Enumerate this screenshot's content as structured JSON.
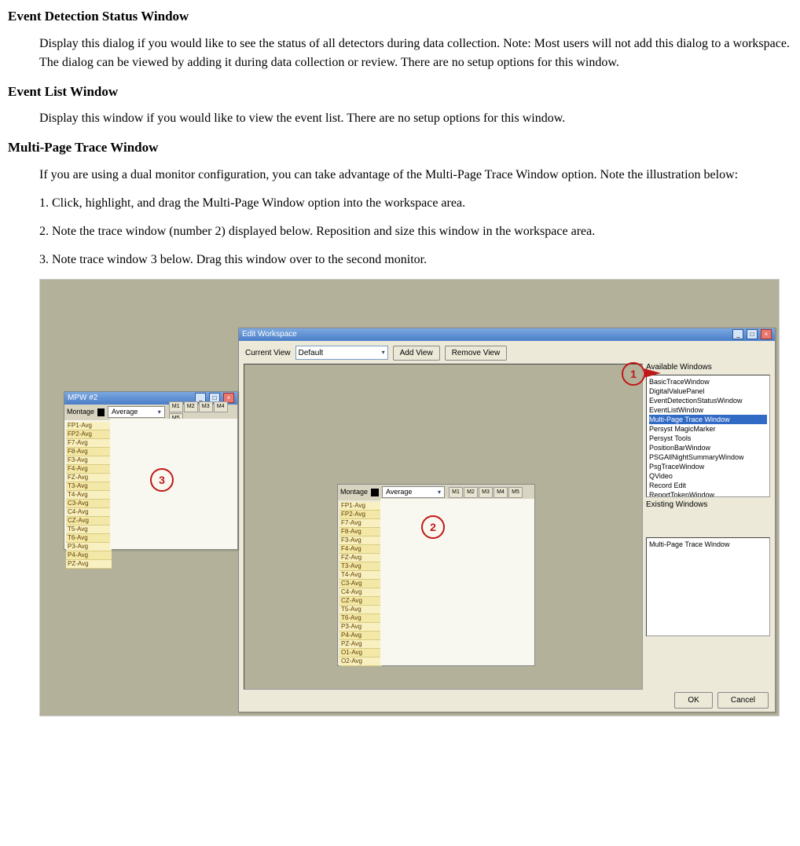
{
  "sections": {
    "s1": {
      "heading": "Event Detection Status Window",
      "body": "Display this dialog if you would like to see the status of all detectors during data collection.  Note:  Most users will not add this dialog to a workspace.  The dialog can be viewed by adding it during data collection or review.  There are no setup options for this window."
    },
    "s2": {
      "heading": "Event List Window",
      "body": "Display this window if you would like to view the event list.  There are no setup options for this window."
    },
    "s3": {
      "heading": "Multi-Page Trace Window",
      "intro": "If you are using a dual monitor configuration, you can take advantage of the Multi-Page Trace Window option.  Note the illustration below:",
      "step1": "1.  Click, highlight, and drag the Multi-Page Window option into the workspace area.",
      "step2": "2.  Note the trace window (number 2) displayed below.  Reposition and size this window in the workspace area.",
      "step3": "3.  Note trace window 3 below.  Drag this window over to the second monitor."
    }
  },
  "dialog": {
    "title": "Edit Workspace",
    "current_view_label": "Current View",
    "current_view_value": "Default",
    "add_view": "Add View",
    "remove_view": "Remove View",
    "available_label": "Available Windows",
    "available": [
      "BasicTraceWindow",
      "DigitalValuePanel",
      "EventDetectionStatusWindow",
      "EventListWindow",
      "Multi-Page Trace Window",
      "Persyst MagicMarker",
      "Persyst Tools",
      "PositionBarWindow",
      "PSGAllNightSummaryWindow",
      "PsgTraceWindow",
      "QVideo",
      "Record Edit",
      "ReportTokenWindow"
    ],
    "available_selected_index": 4,
    "existing_label": "Existing Windows",
    "existing": [
      "Multi-Page Trace Window"
    ],
    "ok": "OK",
    "cancel": "Cancel"
  },
  "mpw": {
    "float_title": "MPW #2",
    "montage_label": "Montage",
    "montage_value": "Average",
    "toolbar_codes": [
      "M1",
      "M2",
      "M3",
      "M4",
      "M5"
    ],
    "channels_short": [
      "FP1-Avg",
      "FP2-Avg",
      "F7-Avg",
      "F8-Avg",
      "F3-Avg",
      "F4-Avg",
      "FZ-Avg",
      "T3-Avg",
      "T4-Avg",
      "C3-Avg",
      "C4-Avg",
      "CZ-Avg",
      "T5-Avg",
      "T6-Avg",
      "P3-Avg",
      "P4-Avg",
      "PZ-Avg",
      "O1-Avg",
      "O2-Avg"
    ]
  },
  "callouts": {
    "c1": "1",
    "c2": "2",
    "c3": "3"
  }
}
